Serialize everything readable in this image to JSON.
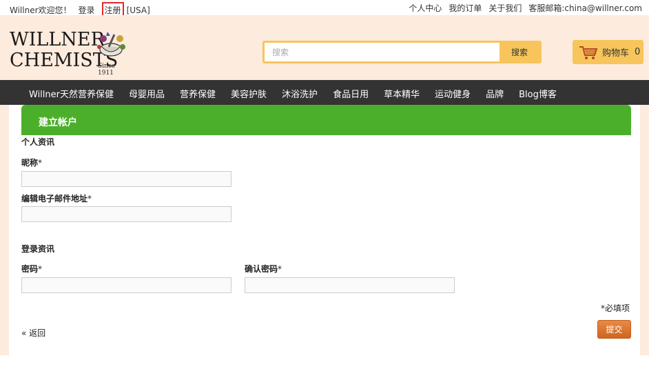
{
  "topbar": {
    "welcome": "Willner欢迎您！",
    "login": "登录",
    "register": "注册",
    "region": "[USA]",
    "account": "个人中心",
    "orders": "我的订单",
    "about": "关于我们",
    "email_label": "客服邮箱:",
    "email": "china@willner.com"
  },
  "logo": {
    "line1": "WILLNER",
    "line2": "CHEMISTS",
    "since": "Since 1911"
  },
  "search": {
    "placeholder": "搜索",
    "button": "搜索"
  },
  "cart": {
    "label": "购物车",
    "count": "0"
  },
  "nav": {
    "items": [
      "Willner天然营养保健",
      "母婴用品",
      "营养保健",
      "美容护肤",
      "沐浴洗护",
      "食品日用",
      "草本精华",
      "运动健身",
      "品牌",
      "Blog博客"
    ]
  },
  "form": {
    "title": "建立帐户",
    "personal_section": "个人资讯",
    "nickname_label": "昵称",
    "email_label": "编辑电子邮件地址",
    "login_section": "登录资讯",
    "password_label": "密码",
    "confirm_label": "确认密码",
    "required_mark": "*",
    "required_note": "*必填项",
    "back": "« 返回",
    "submit": "提交"
  },
  "colors": {
    "header_bg": "#fdebdd",
    "nav_bg": "#333333",
    "accent_yellow": "#f7c55b",
    "form_header_green": "#4caf2b",
    "submit_orange": "#d9712a"
  }
}
